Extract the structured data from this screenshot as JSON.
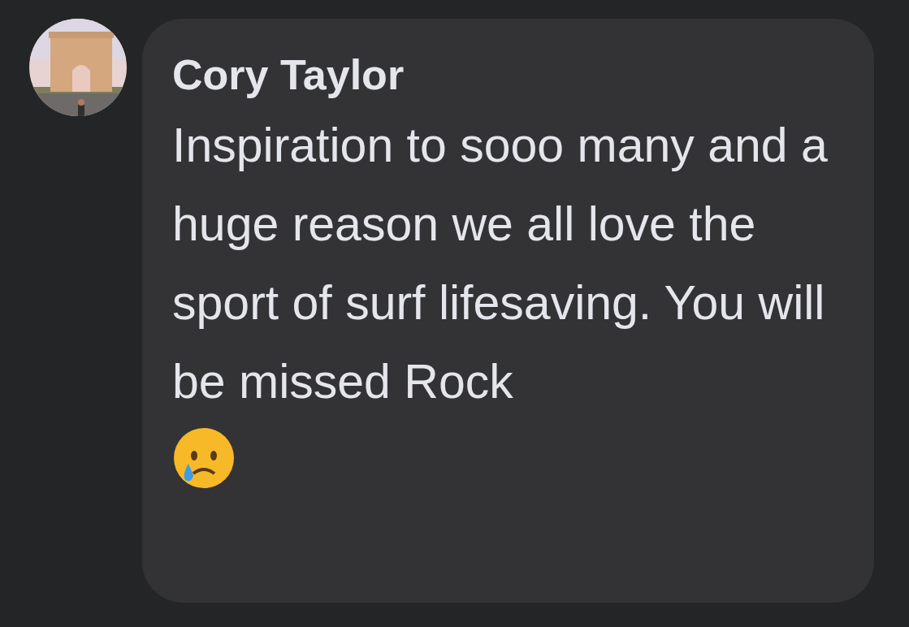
{
  "comment": {
    "author": "Cory Taylor",
    "text": "Inspiration to sooo many and a huge reason we all love the sport of surf lifesaving. You will be missed Rock"
  }
}
